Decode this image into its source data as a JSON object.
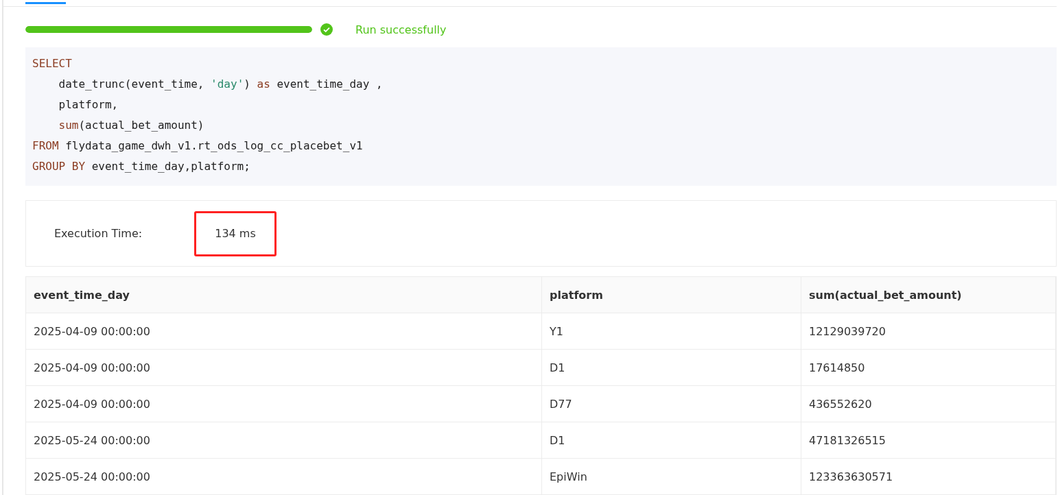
{
  "progress": {
    "level": 1,
    "succeeded": true,
    "message": "Run successfully"
  },
  "code": {
    "lines": [
      [
        {
          "text": "SELECT",
          "kind": "keyword"
        }
      ],
      [
        {
          "text": "    date_trunc(event_time, ",
          "kind": "plain"
        },
        {
          "text": "'day'",
          "kind": "string"
        },
        {
          "text": ") ",
          "kind": "plain"
        },
        {
          "text": "as",
          "kind": "keyword"
        },
        {
          "text": " event_time_day ,",
          "kind": "plain"
        }
      ],
      [
        {
          "text": "    platform,",
          "kind": "plain"
        }
      ],
      [
        {
          "text": "    sum",
          "kind": "keyword"
        },
        {
          "text": "(actual_bet_amount)",
          "kind": "plain"
        }
      ],
      [
        {
          "text": "FROM",
          "kind": "keyword"
        },
        {
          "text": " flydata_game_dwh_v1.rt_ods_log_cc_placebet_v1",
          "kind": "plain"
        }
      ],
      [
        {
          "text": "GROUP BY",
          "kind": "keyword"
        },
        {
          "text": " event_time_day,platform;",
          "kind": "plain"
        }
      ]
    ]
  },
  "execution": {
    "label": "Execution Time:",
    "value": "134 ms",
    "highlighted": true
  },
  "table": {
    "columns": [
      "event_time_day",
      "platform",
      "sum(actual_bet_amount)"
    ],
    "rows": [
      [
        "2025-04-09 00:00:00",
        "Y1",
        "12129039720"
      ],
      [
        "2025-04-09 00:00:00",
        "D1",
        "17614850"
      ],
      [
        "2025-04-09 00:00:00",
        "D77",
        "436552620"
      ],
      [
        "2025-05-24 00:00:00",
        "D1",
        "47181326515"
      ],
      [
        "2025-05-24 00:00:00",
        "EpiWin",
        "123363630571"
      ]
    ]
  }
}
